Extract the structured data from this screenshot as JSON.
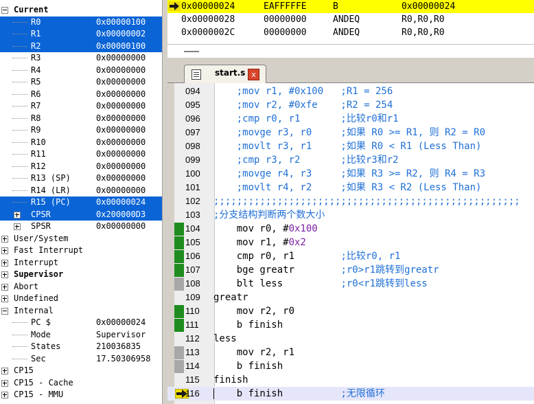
{
  "register_tree": {
    "rows": [
      {
        "name": "Current",
        "value": "",
        "bold": true,
        "expander": "minus",
        "indent": 0,
        "selected": false
      },
      {
        "name": "R0",
        "value": "0x00000100",
        "indent": 2,
        "selected": true
      },
      {
        "name": "R1",
        "value": "0x00000002",
        "indent": 2,
        "selected": true
      },
      {
        "name": "R2",
        "value": "0x00000100",
        "indent": 2,
        "selected": true
      },
      {
        "name": "R3",
        "value": "0x00000000",
        "indent": 2,
        "selected": false
      },
      {
        "name": "R4",
        "value": "0x00000000",
        "indent": 2,
        "selected": false
      },
      {
        "name": "R5",
        "value": "0x00000000",
        "indent": 2,
        "selected": false
      },
      {
        "name": "R6",
        "value": "0x00000000",
        "indent": 2,
        "selected": false
      },
      {
        "name": "R7",
        "value": "0x00000000",
        "indent": 2,
        "selected": false
      },
      {
        "name": "R8",
        "value": "0x00000000",
        "indent": 2,
        "selected": false
      },
      {
        "name": "R9",
        "value": "0x00000000",
        "indent": 2,
        "selected": false
      },
      {
        "name": "R10",
        "value": "0x00000000",
        "indent": 2,
        "selected": false
      },
      {
        "name": "R11",
        "value": "0x00000000",
        "indent": 2,
        "selected": false
      },
      {
        "name": "R12",
        "value": "0x00000000",
        "indent": 2,
        "selected": false
      },
      {
        "name": "R13 (SP)",
        "value": "0x00000000",
        "indent": 2,
        "selected": false
      },
      {
        "name": "R14 (LR)",
        "value": "0x00000000",
        "indent": 2,
        "selected": false
      },
      {
        "name": "R15 (PC)",
        "value": "0x00000024",
        "indent": 2,
        "selected": true
      },
      {
        "name": "CPSR",
        "value": "0x200000D3",
        "indent": 2,
        "expander": "plus",
        "selected": true
      },
      {
        "name": "SPSR",
        "value": "0x00000000",
        "indent": 2,
        "expander": "plus",
        "selected": false
      },
      {
        "name": "User/System",
        "value": "",
        "indent": 0,
        "expander": "plus",
        "selected": false
      },
      {
        "name": "Fast Interrupt",
        "value": "",
        "indent": 0,
        "expander": "plus",
        "selected": false
      },
      {
        "name": "Interrupt",
        "value": "",
        "indent": 0,
        "expander": "plus",
        "selected": false
      },
      {
        "name": "Supervisor",
        "value": "",
        "bold": true,
        "indent": 0,
        "expander": "plus",
        "selected": false
      },
      {
        "name": "Abort",
        "value": "",
        "indent": 0,
        "expander": "plus",
        "selected": false
      },
      {
        "name": "Undefined",
        "value": "",
        "indent": 0,
        "expander": "plus",
        "selected": false
      },
      {
        "name": "Internal",
        "value": "",
        "indent": 0,
        "expander": "minus",
        "selected": false
      },
      {
        "name": "PC  $",
        "value": "0x00000024",
        "indent": 2,
        "selected": false
      },
      {
        "name": "Mode",
        "value": "Supervisor",
        "indent": 2,
        "selected": false
      },
      {
        "name": "States",
        "value": "210036835",
        "indent": 2,
        "selected": false
      },
      {
        "name": "Sec",
        "value": "17.50306958",
        "indent": 2,
        "selected": false
      },
      {
        "name": "CP15",
        "value": "",
        "indent": 0,
        "expander": "plus",
        "selected": false
      },
      {
        "name": "CP15 - Cache",
        "value": "",
        "indent": 0,
        "expander": "plus",
        "selected": false
      },
      {
        "name": "CP15 - MMU",
        "value": "",
        "indent": 0,
        "expander": "plus",
        "selected": false
      }
    ]
  },
  "disassembly": {
    "rows": [
      {
        "addr": "0x00000024",
        "code": "EAFFFFFE",
        "mnemonic": "B",
        "operands": "0x00000024",
        "current": true
      },
      {
        "addr": "0x00000028",
        "code": "00000000",
        "mnemonic": "ANDEQ",
        "operands": "R0,R0,R0",
        "current": false
      },
      {
        "addr": "0x0000002C",
        "code": "00000000",
        "mnemonic": "ANDEQ",
        "operands": "R0,R0,R0",
        "current": false
      }
    ]
  },
  "editor": {
    "tab": {
      "filename": "start.s",
      "close_label": "x"
    },
    "lines": [
      {
        "num": "094",
        "bp": "none",
        "segs": [
          {
            "t": "    ;mov r1, #0x100   ;R1 = 256",
            "c": "comment"
          }
        ]
      },
      {
        "num": "095",
        "bp": "none",
        "segs": [
          {
            "t": "    ;mov r2, #0xfe    ;R2 = 254",
            "c": "comment"
          }
        ]
      },
      {
        "num": "096",
        "bp": "none",
        "segs": [
          {
            "t": "    ;cmp r0, r1       ;比较r0和r1",
            "c": "comment"
          }
        ]
      },
      {
        "num": "097",
        "bp": "none",
        "segs": [
          {
            "t": "    ;movge r3, r0     ;如果 R0 >= R1, 则 R2 = R0",
            "c": "comment"
          }
        ]
      },
      {
        "num": "098",
        "bp": "none",
        "segs": [
          {
            "t": "    ;movlt r3, r1     ;如果 R0 < R1 (Less Than)",
            "c": "comment"
          }
        ]
      },
      {
        "num": "099",
        "bp": "none",
        "segs": [
          {
            "t": "    ;cmp r3, r2       ;比较r3和r2",
            "c": "comment"
          }
        ]
      },
      {
        "num": "100",
        "bp": "none",
        "segs": [
          {
            "t": "    ;movge r4, r3     ;如果 R3 >= R2, 则 R4 = R3",
            "c": "comment"
          }
        ]
      },
      {
        "num": "101",
        "bp": "none",
        "segs": [
          {
            "t": "    ;movlt r4, r2     ;如果 R3 < R2 (Less Than)",
            "c": "comment"
          }
        ]
      },
      {
        "num": "102",
        "bp": "none",
        "segs": [
          {
            "t": ";;;;;;;;;;;;;;;;;;;;;;;;;;;;;;;;;;;;;;;;;;;;;;;;;;;;;",
            "c": "comment"
          }
        ]
      },
      {
        "num": "103",
        "bp": "none",
        "segs": [
          {
            "t": ";分支结构判断两个数大小",
            "c": "comment"
          }
        ]
      },
      {
        "num": "104",
        "bp": "green",
        "segs": [
          {
            "t": "    mov r0, #",
            "c": "plain"
          },
          {
            "t": "0x100",
            "c": "num"
          }
        ]
      },
      {
        "num": "105",
        "bp": "green",
        "segs": [
          {
            "t": "    mov r1, #",
            "c": "plain"
          },
          {
            "t": "0x2",
            "c": "num"
          }
        ]
      },
      {
        "num": "106",
        "bp": "green",
        "segs": [
          {
            "t": "    cmp r0, r1",
            "c": "plain"
          },
          {
            "t": "        ;比较r0, r1",
            "c": "comment"
          }
        ]
      },
      {
        "num": "107",
        "bp": "green",
        "segs": [
          {
            "t": "    bge greatr",
            "c": "plain"
          },
          {
            "t": "        ;r0>r1跳转到greatr",
            "c": "comment"
          }
        ]
      },
      {
        "num": "108",
        "bp": "gray",
        "segs": [
          {
            "t": "    blt less",
            "c": "plain"
          },
          {
            "t": "          ;r0<r1跳转到less",
            "c": "comment"
          }
        ]
      },
      {
        "num": "109",
        "bp": "none",
        "segs": [
          {
            "t": "greatr",
            "c": "plain"
          }
        ]
      },
      {
        "num": "110",
        "bp": "green",
        "segs": [
          {
            "t": "    mov r2, r0",
            "c": "plain"
          }
        ]
      },
      {
        "num": "111",
        "bp": "green",
        "segs": [
          {
            "t": "    b finish",
            "c": "plain"
          }
        ]
      },
      {
        "num": "112",
        "bp": "none",
        "segs": [
          {
            "t": "less",
            "c": "plain"
          }
        ]
      },
      {
        "num": "113",
        "bp": "gray",
        "segs": [
          {
            "t": "    mov r2, r1",
            "c": "plain"
          }
        ]
      },
      {
        "num": "114",
        "bp": "gray",
        "segs": [
          {
            "t": "    b finish",
            "c": "plain"
          }
        ]
      },
      {
        "num": "115",
        "bp": "none",
        "segs": [
          {
            "t": "finish",
            "c": "plain"
          }
        ]
      },
      {
        "num": "116",
        "bp": "current",
        "segs": [
          {
            "t": "    b finish",
            "c": "plain"
          },
          {
            "t": "          ;无限循环",
            "c": "comment"
          }
        ]
      }
    ]
  },
  "colors": {
    "selection": "#0a64d6",
    "current_pc": "#ffff00",
    "comment": "#1e6fd6",
    "number": "#7a1fa2",
    "bp_green": "#1e8c1e",
    "bp_gray": "#a8a8a8"
  }
}
